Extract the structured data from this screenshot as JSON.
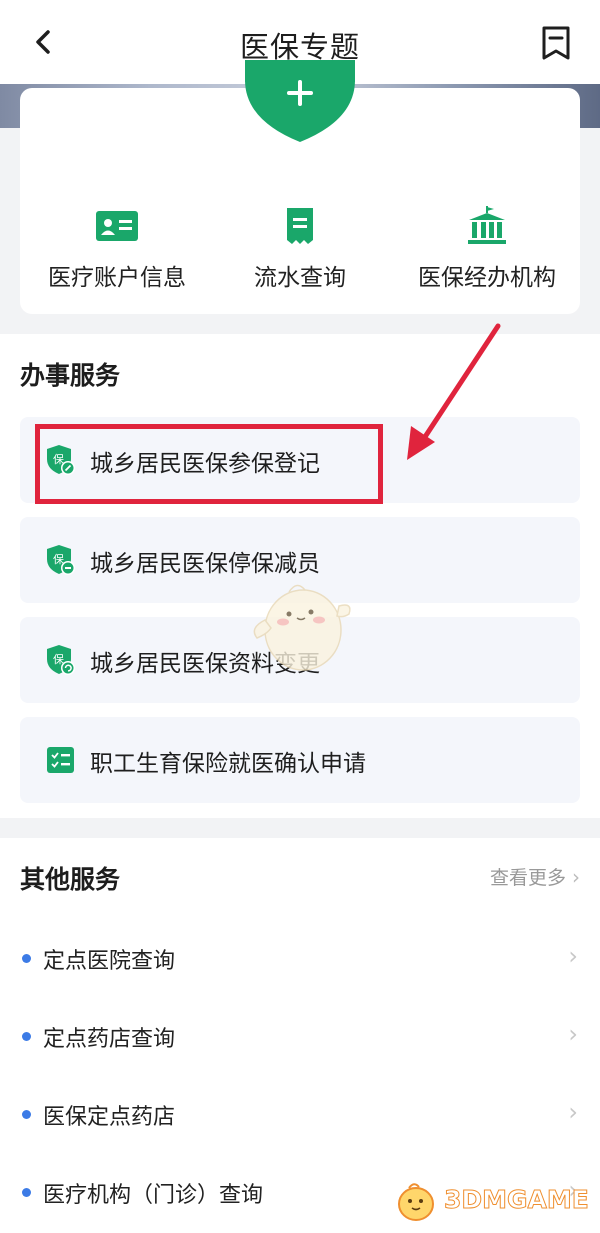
{
  "header": {
    "title": "医保专题",
    "back_icon": "back-icon",
    "bookmark_icon": "bookmark-icon"
  },
  "quick_actions": [
    {
      "label": "医疗账户信息",
      "icon": "id-card-icon"
    },
    {
      "label": "流水查询",
      "icon": "receipt-icon"
    },
    {
      "label": "医保经办机构",
      "icon": "institution-icon"
    }
  ],
  "services": {
    "title": "办事服务",
    "items": [
      {
        "label": "城乡居民医保参保登记",
        "icon": "shield-edit-icon"
      },
      {
        "label": "城乡居民医保停保减员",
        "icon": "shield-minus-icon"
      },
      {
        "label": "城乡居民医保资料变更",
        "icon": "shield-refresh-icon"
      },
      {
        "label": "职工生育保险就医确认申请",
        "icon": "checklist-icon"
      }
    ]
  },
  "other_services": {
    "title": "其他服务",
    "more_label": "查看更多",
    "items": [
      {
        "label": "定点医院查询"
      },
      {
        "label": "定点药店查询"
      },
      {
        "label": "医保定点药店"
      },
      {
        "label": "医疗机构（门诊）查询"
      }
    ]
  },
  "watermark": {
    "text": "3DMGAME"
  },
  "colors": {
    "accent_green": "#1aa76a",
    "annotation_red": "#e0243d",
    "bullet_blue": "#3c7be6"
  }
}
